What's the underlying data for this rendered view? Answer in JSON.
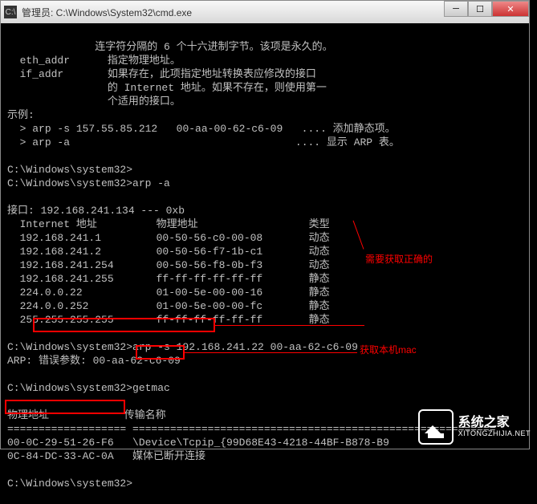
{
  "window": {
    "title": "管理员: C:\\Windows\\System32\\cmd.exe",
    "icon_glyph": "C:\\"
  },
  "help": {
    "line1": "              连字符分隔的 6 个十六进制字节。该项是永久的。",
    "eth_label": "eth_addr",
    "eth_desc": "指定物理地址。",
    "if_label": "if_addr",
    "if_desc1": "如果存在，此项指定地址转换表应修改的接口",
    "if_desc2": "的 Internet 地址。如果不存在，则使用第一",
    "if_desc3": "个适用的接口。"
  },
  "examples": {
    "header": "示例:",
    "ex1_cmd": "> arp -s 157.55.85.212   00-aa-00-62-c6-09",
    "ex1_desc": ".... 添加静态项。",
    "ex2_cmd": "> arp -a",
    "ex2_desc": ".... 显示 ARP 表。"
  },
  "prompts": {
    "p1": "C:\\Windows\\system32>",
    "p2": "C:\\Windows\\system32>arp -a",
    "p3": "C:\\Windows\\system32>arp -s 192.168.241.22 00-aa-62-c6-09",
    "p4": "C:\\Windows\\system32>getmac",
    "p5": "C:\\Windows\\system32>"
  },
  "arp": {
    "iface": "接口: 192.168.241.134 --- 0xb",
    "hdr_ip": "Internet 地址",
    "hdr_mac": "物理地址",
    "hdr_type": "类型",
    "rows": [
      {
        "ip": "192.168.241.1",
        "mac": "00-50-56-c0-00-08",
        "type": "动态"
      },
      {
        "ip": "192.168.241.2",
        "mac": "00-50-56-f7-1b-c1",
        "type": "动态"
      },
      {
        "ip": "192.168.241.254",
        "mac": "00-50-56-f8-0b-f3",
        "type": "动态"
      },
      {
        "ip": "192.168.241.255",
        "mac": "ff-ff-ff-ff-ff-ff",
        "type": "静态"
      },
      {
        "ip": "224.0.0.22",
        "mac": "01-00-5e-00-00-16",
        "type": "静态"
      },
      {
        "ip": "224.0.0.252",
        "mac": "01-00-5e-00-00-fc",
        "type": "静态"
      },
      {
        "ip": "255.255.255.255",
        "mac": "ff-ff-ff-ff-ff-ff",
        "type": "静态"
      }
    ]
  },
  "arp_error": "ARP: 错误参数: 00-aa-62-c6-09",
  "getmac": {
    "hdr_mac": "物理地址",
    "hdr_transport": "传输名称",
    "divider": "=================== ==========================================================",
    "row1_mac": "00-0C-29-51-26-F6",
    "row1_transport": "\\Device\\Tcpip_{99D68E43-4218-44BF-B878-B9",
    "row2_mac": "0C-84-DC-33-AC-0A",
    "row2_transport": "媒体已断开连接"
  },
  "annotations": {
    "note_correct": "需要获取正确的",
    "note_local": "获取本机mac"
  },
  "watermark": {
    "cn": "系统之家",
    "en": "XITONGZHIJIA.NET"
  }
}
